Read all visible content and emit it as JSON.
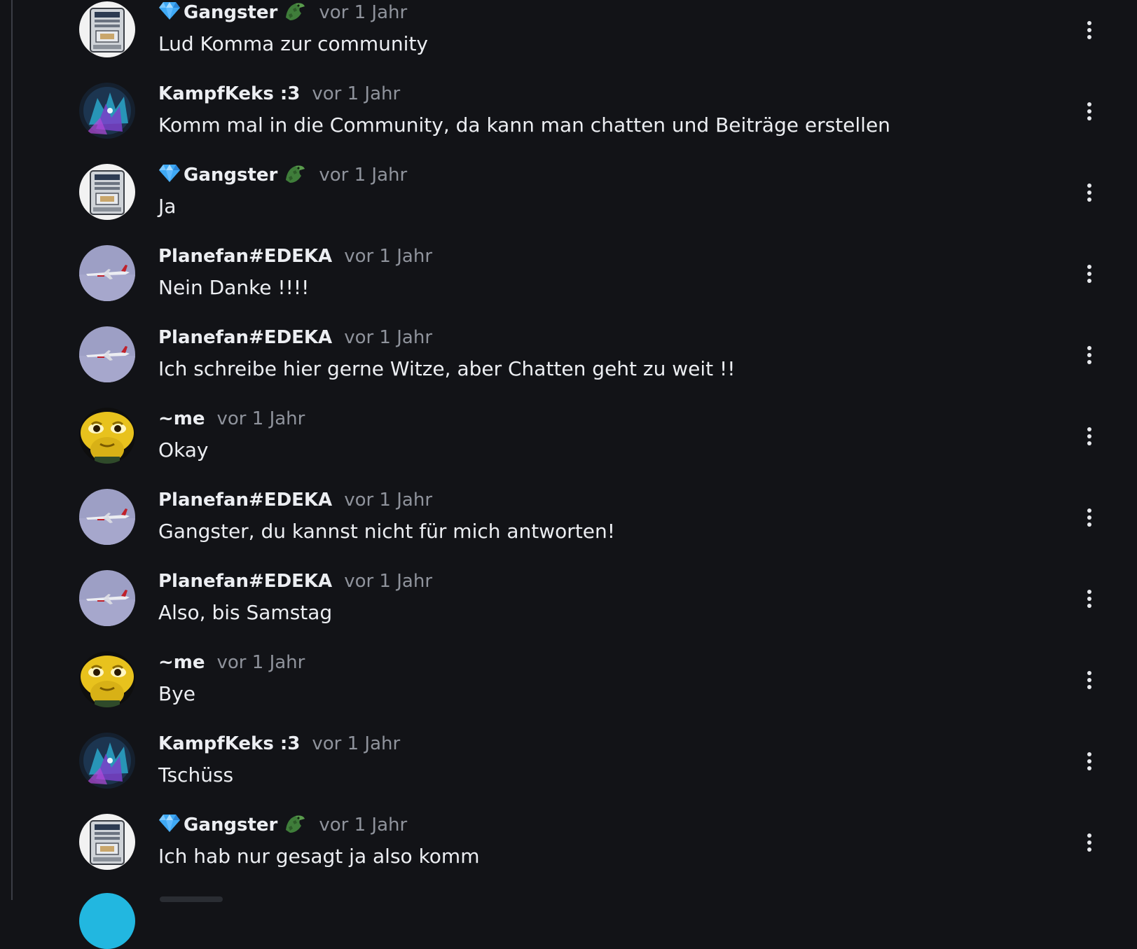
{
  "comments": [
    {
      "author": "Gangster",
      "badges": [
        "gem-icon",
        "crocodile-icon"
      ],
      "avatar": "money-counter-avatar",
      "time": "vor 1 Jahr",
      "text": "Lud Komma zur community"
    },
    {
      "author": "KampfKeks :3",
      "badges": [],
      "avatar": "wolf-art-avatar",
      "time": "vor 1 Jahr",
      "text": "Komm mal in die Community, da kann man chatten und Beiträge erstellen"
    },
    {
      "author": "Gangster",
      "badges": [
        "gem-icon",
        "crocodile-icon"
      ],
      "avatar": "money-counter-avatar",
      "time": "vor 1 Jahr",
      "text": "Ja"
    },
    {
      "author": "Planefan#EDEKA",
      "badges": [],
      "avatar": "airplane-avatar",
      "time": "vor 1 Jahr",
      "text": "Nein Danke !!!!"
    },
    {
      "author": "Planefan#EDEKA",
      "badges": [],
      "avatar": "airplane-avatar",
      "time": "vor 1 Jahr",
      "text": "Ich schreibe hier gerne Witze, aber Chatten geht zu weit !!"
    },
    {
      "author": "~me",
      "badges": [],
      "avatar": "yellow-alien-avatar",
      "time": "vor 1 Jahr",
      "text": "Okay"
    },
    {
      "author": "Planefan#EDEKA",
      "badges": [],
      "avatar": "airplane-avatar",
      "time": "vor 1 Jahr",
      "text": "Gangster, du kannst nicht für mich antworten!"
    },
    {
      "author": "Planefan#EDEKA",
      "badges": [],
      "avatar": "airplane-avatar",
      "time": "vor 1 Jahr",
      "text": "Also, bis Samstag"
    },
    {
      "author": "~me",
      "badges": [],
      "avatar": "yellow-alien-avatar",
      "time": "vor 1 Jahr",
      "text": "Bye"
    },
    {
      "author": "KampfKeks :3",
      "badges": [],
      "avatar": "wolf-art-avatar",
      "time": "vor 1 Jahr",
      "text": "Tschüss"
    },
    {
      "author": "Gangster",
      "badges": [
        "gem-icon",
        "crocodile-icon"
      ],
      "avatar": "money-counter-avatar",
      "time": "vor 1 Jahr",
      "text": "Ich hab nur gesagt ja also komm"
    }
  ],
  "colors": {
    "background": "#121317",
    "text": "#eceef2",
    "muted": "#8f939c"
  }
}
